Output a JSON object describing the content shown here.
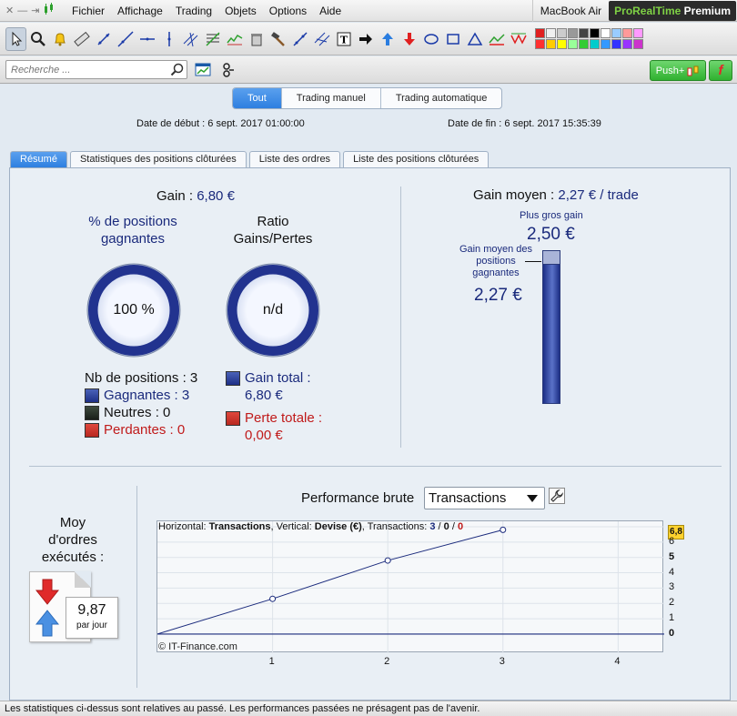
{
  "menubar": {
    "items": [
      {
        "label": "Fichier"
      },
      {
        "label": "Affichage"
      },
      {
        "label": "Trading"
      },
      {
        "label": "Objets"
      },
      {
        "label": "Options"
      },
      {
        "label": "Aide"
      }
    ],
    "device": "MacBook Air",
    "brand_pr": "ProRealTime",
    "brand_premium": "Premium"
  },
  "toolbar": {
    "palette": [
      "#e02020",
      "#f0f0f0",
      "#cccccc",
      "#999999",
      "#444444",
      "#000000",
      "#ffffff",
      "#99ccff",
      "#ff9999",
      "#ff99ff",
      "#ff3030",
      "#ffcc00",
      "#ffff00",
      "#99ff99",
      "#33cc33",
      "#00cccc",
      "#3399ff",
      "#3333ff",
      "#9933ff",
      "#cc33cc"
    ]
  },
  "search": {
    "placeholder": "Recherche ..."
  },
  "buttons": {
    "push": "Push+",
    "f_label": "f"
  },
  "main_tabs": [
    {
      "label": "Tout",
      "active": true
    },
    {
      "label": "Trading manuel",
      "active": false
    },
    {
      "label": "Trading automatique",
      "active": false
    }
  ],
  "dates": {
    "start_label": "Date de début :",
    "start": "6 sept. 2017 01:00:00",
    "end_label": "Date de fin :",
    "end": "6 sept. 2017 15:35:39"
  },
  "sub_tabs": [
    {
      "label": "Résumé",
      "active": true
    },
    {
      "label": "Statistiques des positions clôturées",
      "active": false
    },
    {
      "label": "Liste des ordres",
      "active": false
    },
    {
      "label": "Liste des positions clôturées",
      "active": false
    }
  ],
  "gain": {
    "label": "Gain :",
    "value": "6,80 €"
  },
  "pct_winning": {
    "label": "% de positions gagnantes",
    "value": "100 %",
    "fraction": 1.0
  },
  "ratio": {
    "label": "Ratio Gains/Pertes",
    "value": "n/d"
  },
  "positions": {
    "count_label": "Nb de positions : 3",
    "winning": "Gagnantes : 3",
    "neutral": "Neutres : 0",
    "losing": "Perdantes : 0"
  },
  "totals": {
    "gain_label": "Gain total :",
    "gain_value": "6,80 €",
    "loss_label": "Perte totale :",
    "loss_value": "0,00 €"
  },
  "avg_gain": {
    "label": "Gain moyen :",
    "value": "2,27 € / trade",
    "biggest_label": "Plus gros gain",
    "biggest_value": "2,50 €",
    "avg_win_label": "Gain moyen des positions gagnantes",
    "avg_win_value": "2,27 €"
  },
  "orders": {
    "label": "Moy d'ordres exécutés :",
    "value": "9,87",
    "unit": "par jour"
  },
  "performance": {
    "title": "Performance brute",
    "select_value": "Transactions",
    "header_prefix": "Horizontal: ",
    "header_h": "Transactions",
    "header_mid": ", Vertical: ",
    "header_v": "Devise (€)",
    "header_tx": ", Transactions: ",
    "tx_total": "3",
    "tx_sep1": " / ",
    "tx_zero1": "0",
    "tx_sep2": " / ",
    "tx_zero2": "0",
    "copyright": "© IT-Finance.com",
    "last_value": "6,8"
  },
  "chart_data": {
    "type": "line",
    "x": [
      0,
      1,
      2,
      3
    ],
    "values": [
      0,
      2.3,
      4.8,
      6.8
    ],
    "xlim": [
      0,
      4.4
    ],
    "ylim": [
      -0.3,
      7
    ],
    "x_ticks": [
      "1",
      "2",
      "3",
      "4"
    ],
    "y_ticks": [
      "0",
      "1",
      "2",
      "3",
      "4",
      "5",
      "6"
    ],
    "color": "#1a2a7c"
  },
  "footer": {
    "text": "Les statistiques ci-dessus sont relatives au passé. Les performances passées ne présagent pas de l'avenir."
  }
}
